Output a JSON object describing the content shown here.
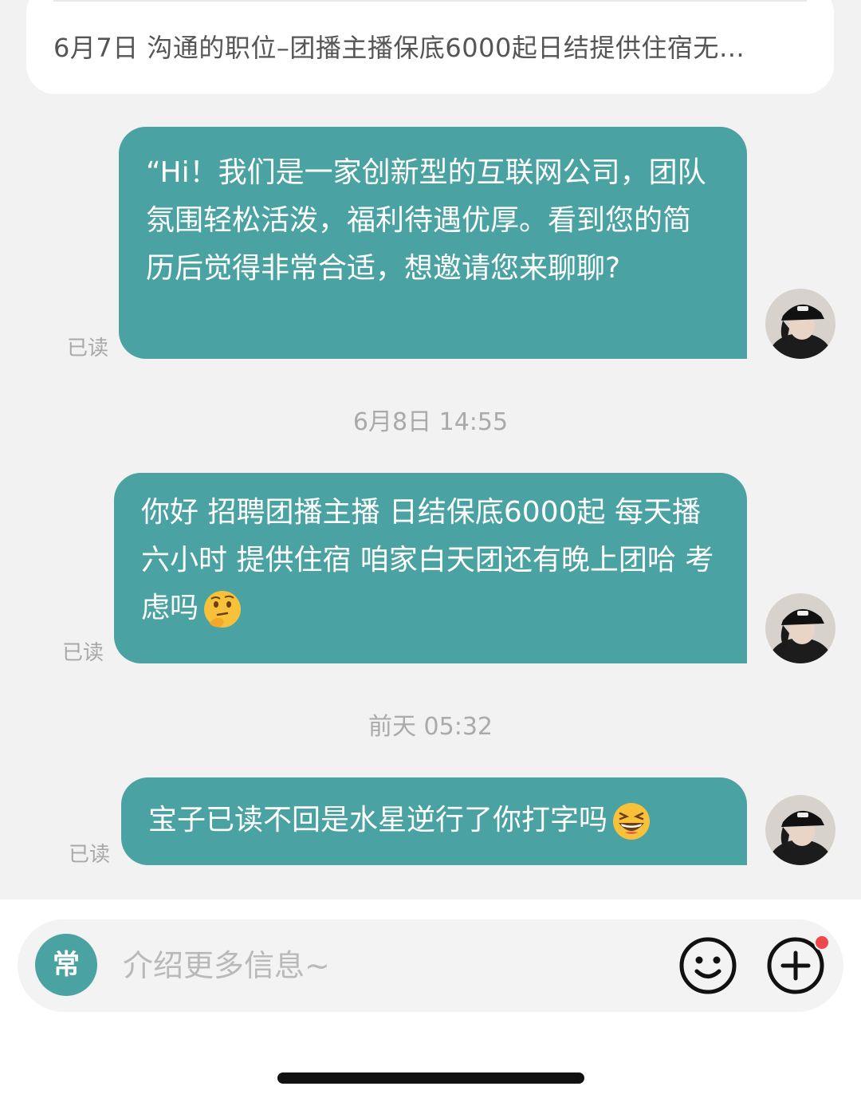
{
  "header": {
    "job_line": "6月7日 沟通的职位–团播主播保底6000起日结提供住宿无…"
  },
  "messages": [
    {
      "text": "“Hi！我们是一家创新型的互联网公司，团队氛围轻松活泼，福利待遇优厚。看到您的简历后觉得非常合适，想邀请您来聊聊?",
      "status": "已读"
    },
    {
      "text": "你好 招聘团播主播 日结保底6000起 每天播六小时 提供住宿 咱家白天团还有晚上团哈 考虑吗",
      "emoji": "thinking-face",
      "status": "已读"
    },
    {
      "text": "宝子已读不回是水星逆行了你打字吗",
      "emoji": "grinning-squinting-face",
      "status": "已读"
    }
  ],
  "timestamps": [
    "6月8日 14:55",
    "前天 05:32"
  ],
  "input_bar": {
    "quick_reply_label": "常",
    "placeholder": "介绍更多信息~",
    "emoji_icon": "smiley-icon",
    "plus_icon": "plus-circle-icon",
    "notification_dot_color": "#f0474a"
  },
  "colors": {
    "bubble": "#4aa3a2",
    "background": "#f2f2f2"
  }
}
